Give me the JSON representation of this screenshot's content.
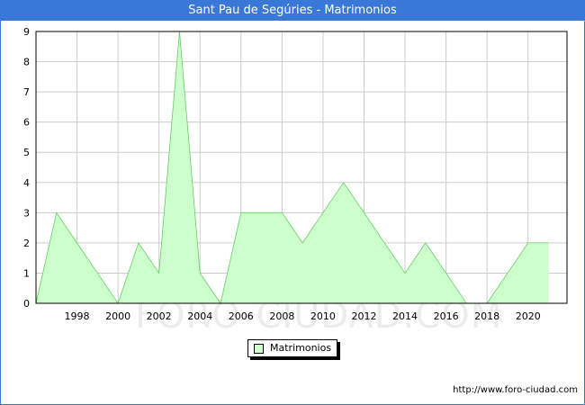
{
  "header": {
    "title": "Sant Pau de Segúries - Matrimonios"
  },
  "watermark": "FORO-CIUDAD.COM",
  "footer": {
    "source": "http://www.foro-ciudad.com"
  },
  "chart_data": {
    "type": "area",
    "title": "Sant Pau de Segúries - Matrimonios",
    "xlabel": "",
    "ylabel": "",
    "x": [
      1996,
      1997,
      1998,
      1999,
      2000,
      2001,
      2002,
      2003,
      2004,
      2005,
      2006,
      2007,
      2008,
      2009,
      2010,
      2011,
      2012,
      2013,
      2014,
      2015,
      2016,
      2017,
      2018,
      2019,
      2020,
      2021
    ],
    "series": [
      {
        "name": "Matrimonios",
        "values": [
          0,
          3,
          2,
          1,
          0,
          2,
          1,
          9,
          1,
          0,
          3,
          3,
          3,
          2,
          3,
          4,
          3,
          2,
          1,
          2,
          1,
          0,
          0,
          1,
          2,
          2
        ]
      }
    ],
    "xlim": [
      1996,
      2021.9
    ],
    "ylim": [
      0,
      9
    ],
    "x_ticks": [
      1998,
      2000,
      2002,
      2004,
      2006,
      2008,
      2010,
      2012,
      2014,
      2016,
      2018,
      2020
    ],
    "y_ticks": [
      0,
      1,
      2,
      3,
      4,
      5,
      6,
      7,
      8,
      9
    ],
    "grid": true,
    "legend_position": "bottom-center",
    "colors": {
      "fill": "#ccffcc",
      "line": "#66cc66",
      "grid": "#cccccc",
      "header": "#3a78d8"
    }
  }
}
